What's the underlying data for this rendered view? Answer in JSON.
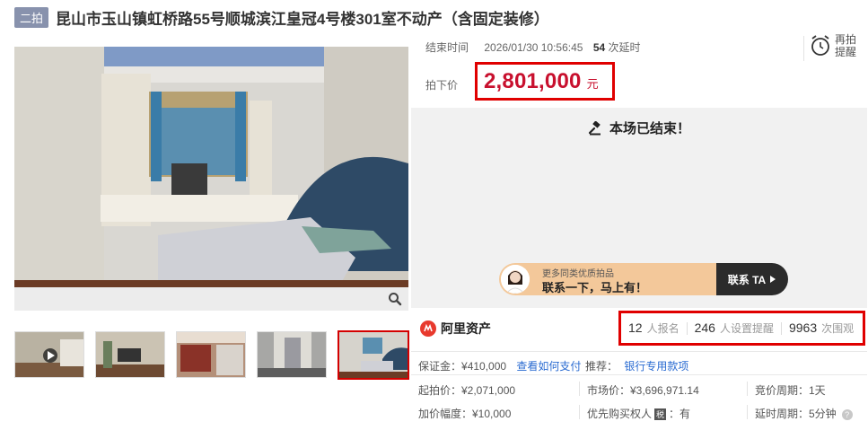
{
  "header": {
    "badge": "二拍",
    "title": "昆山市玉山镇虹桥路55号顺城滨江皇冠4号楼301室不动产（含固定装修）"
  },
  "auction": {
    "end_time_label": "结束时间",
    "end_time": "2026/01/30 10:56:45",
    "extensions_count": "54",
    "extensions_label": "次延时",
    "remind_label": "再拍提醒",
    "price_label": "拍下价",
    "price": "2,801,000",
    "price_unit": "元",
    "ended_text": "本场已结束！"
  },
  "promo": {
    "small_text": "更多同类优质拍品",
    "big_text": "联系一下，马上有！",
    "button_label": "联系 TA"
  },
  "platform": {
    "name": "阿里资产"
  },
  "stats": [
    {
      "num": "12",
      "label": "人报名"
    },
    {
      "num": "246",
      "label": "人设置提醒"
    },
    {
      "num": "9963",
      "label": "次围观"
    }
  ],
  "details": {
    "deposit_label": "保证金：",
    "deposit": "¥410,000",
    "pay_link": "查看如何支付",
    "recommend_label": "推荐：",
    "recommend_link": "银行专用款项",
    "start_price": "起拍价：¥2,071,000",
    "market_price": "市场价：¥3,696,971.14",
    "bid_cycle": "竞价周期：1天",
    "increment": "加价幅度：¥10,000",
    "priority_label": "优先购买权人",
    "priority_badge": "税",
    "priority_value": "：有",
    "delay_cycle": "延时周期：5分钟",
    "help_icon": "?"
  },
  "colors": {
    "accent_red": "#c8102e",
    "highlight_border": "#e00000",
    "link_blue": "#2a6bd1",
    "badge_bg": "#8892ad"
  }
}
